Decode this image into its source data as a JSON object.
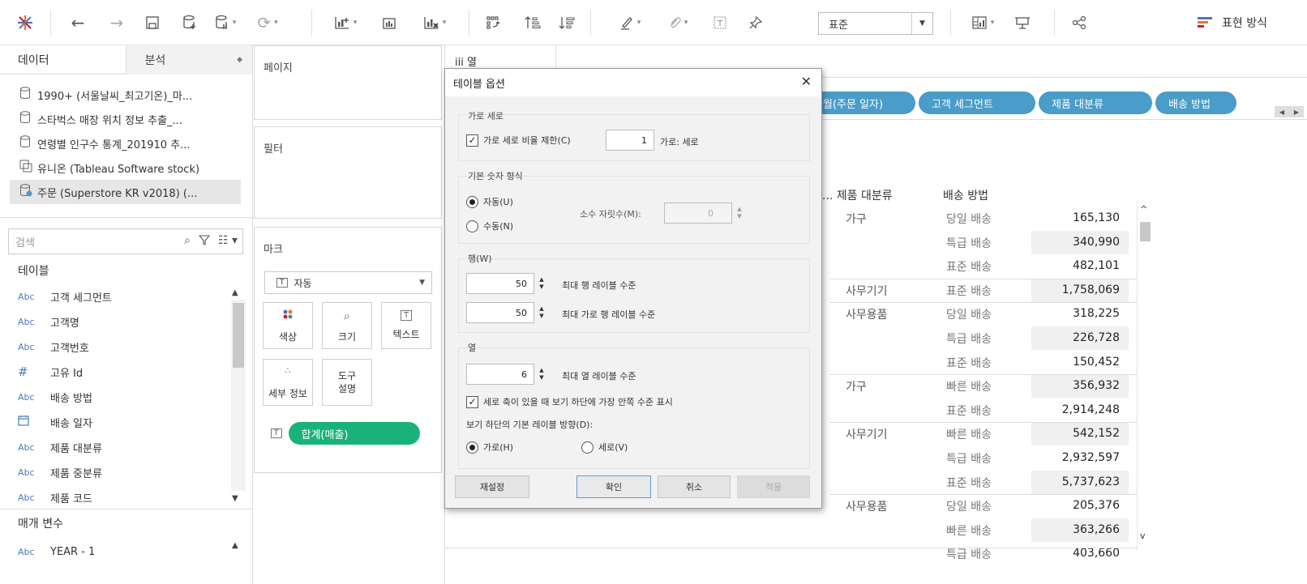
{
  "toolbar": {
    "fit_value": "표준",
    "show_me_label": "표현 방식"
  },
  "data_pane": {
    "tab_data": "데이터",
    "tab_analysis": "분석",
    "datasources": [
      {
        "label": "1990+ (서울날씨_최고기온)_마..."
      },
      {
        "label": "스타벅스 매장 위치 정보 추출_..."
      },
      {
        "label": "연령별 인구수 통계_201910 추..."
      },
      {
        "label": "유니온 (Tableau Software stock)"
      },
      {
        "label": "주문 (Superstore KR v2018) (..."
      }
    ],
    "search_placeholder": "검색",
    "tables_header": "테이블",
    "fields": [
      {
        "type": "Abc",
        "label": "고객 세그먼트"
      },
      {
        "type": "Abc",
        "label": "고객명"
      },
      {
        "type": "Abc",
        "label": "고객번호"
      },
      {
        "type": "#",
        "label": "고유 Id"
      },
      {
        "type": "Abc",
        "label": "배송 방법"
      },
      {
        "type": "date",
        "label": "배송 일자"
      },
      {
        "type": "Abc",
        "label": "제품 대분류"
      },
      {
        "type": "Abc",
        "label": "제품 중분류"
      },
      {
        "type": "Abc",
        "label": "제품 코드"
      }
    ],
    "params_header": "매개 변수",
    "params": [
      {
        "type": "Abc",
        "label": "YEAR - 1"
      }
    ]
  },
  "shelves": {
    "pages": "페이지",
    "filters": "필터",
    "marks": "마크",
    "mark_type": "자동",
    "mark_color": "색상",
    "mark_size": "크기",
    "mark_text": "텍스트",
    "mark_detail": "세부 정보",
    "mark_tooltip": "도구\n설명",
    "mark_pill": "합계(매출)",
    "columns": "열",
    "row_pills": [
      "월(주문 일자)",
      "고객 세그먼트",
      "제품 대분류",
      "배송 방법"
    ]
  },
  "view": {
    "header_cut": "... 제품 대분류",
    "header_shipping": "배송 방법",
    "rows": [
      {
        "cat": "가구",
        "ship": "당일 배송",
        "value": "165,130"
      },
      {
        "cat": "",
        "ship": "특급 배송",
        "value": "340,990"
      },
      {
        "cat": "",
        "ship": "표준 배송",
        "value": "482,101"
      },
      {
        "cat": "사무기기",
        "ship": "표준 배송",
        "value": "1,758,069"
      },
      {
        "cat": "사무용품",
        "ship": "당일 배송",
        "value": "318,225"
      },
      {
        "cat": "",
        "ship": "특급 배송",
        "value": "226,728"
      },
      {
        "cat": "",
        "ship": "표준 배송",
        "value": "150,452"
      },
      {
        "cat": "가구",
        "ship": "빠른 배송",
        "value": "356,932"
      },
      {
        "cat": "",
        "ship": "표준 배송",
        "value": "2,914,248"
      },
      {
        "cat": "사무기기",
        "ship": "빠른 배송",
        "value": "542,152"
      },
      {
        "cat": "",
        "ship": "특급 배송",
        "value": "2,932,597"
      },
      {
        "cat": "",
        "ship": "표준 배송",
        "value": "5,737,623"
      },
      {
        "cat": "사무용품",
        "ship": "당일 배송",
        "value": "205,376"
      },
      {
        "cat": "",
        "ship": "빠른 배송",
        "value": "363,266"
      },
      {
        "cat": "",
        "ship": "특급 배송",
        "value": "403,660"
      }
    ]
  },
  "dialog": {
    "title": "테이블 옵션",
    "group_aspect": "가로 세로",
    "aspect_check": "가로 세로 비율 제한(C)",
    "aspect_value": "1",
    "aspect_suffix": "가로: 세로",
    "group_number": "기본 숫자 형식",
    "radio_auto": "자동(U)",
    "radio_manual": "수동(N)",
    "decimals_label": "소수 자릿수(M):",
    "decimals_value": "0",
    "group_rows": "행(W)",
    "max_row_levels": "50",
    "max_row_levels_label": "최대 행 레이블 수준",
    "max_horiz_row_levels": "50",
    "max_horiz_row_levels_label": "최대 가로 행 레이블 수준",
    "group_cols": "열",
    "max_col_levels": "6",
    "max_col_levels_label": "최대 열 레이블 수준",
    "inner_check": "세로 축이 있을 때 보기 하단에 가장 안쪽 수준 표시",
    "orientation_label": "보기 하단의 기본 레이블 방향(D):",
    "radio_horizontal": "가로(H)",
    "radio_vertical": "세로(V)",
    "btn_reset": "재설정",
    "btn_ok": "확인",
    "btn_cancel": "취소",
    "btn_apply": "적용"
  },
  "colors": {
    "measure_pill": "#19b27a",
    "dimension_pill": "#4a9cc9"
  }
}
